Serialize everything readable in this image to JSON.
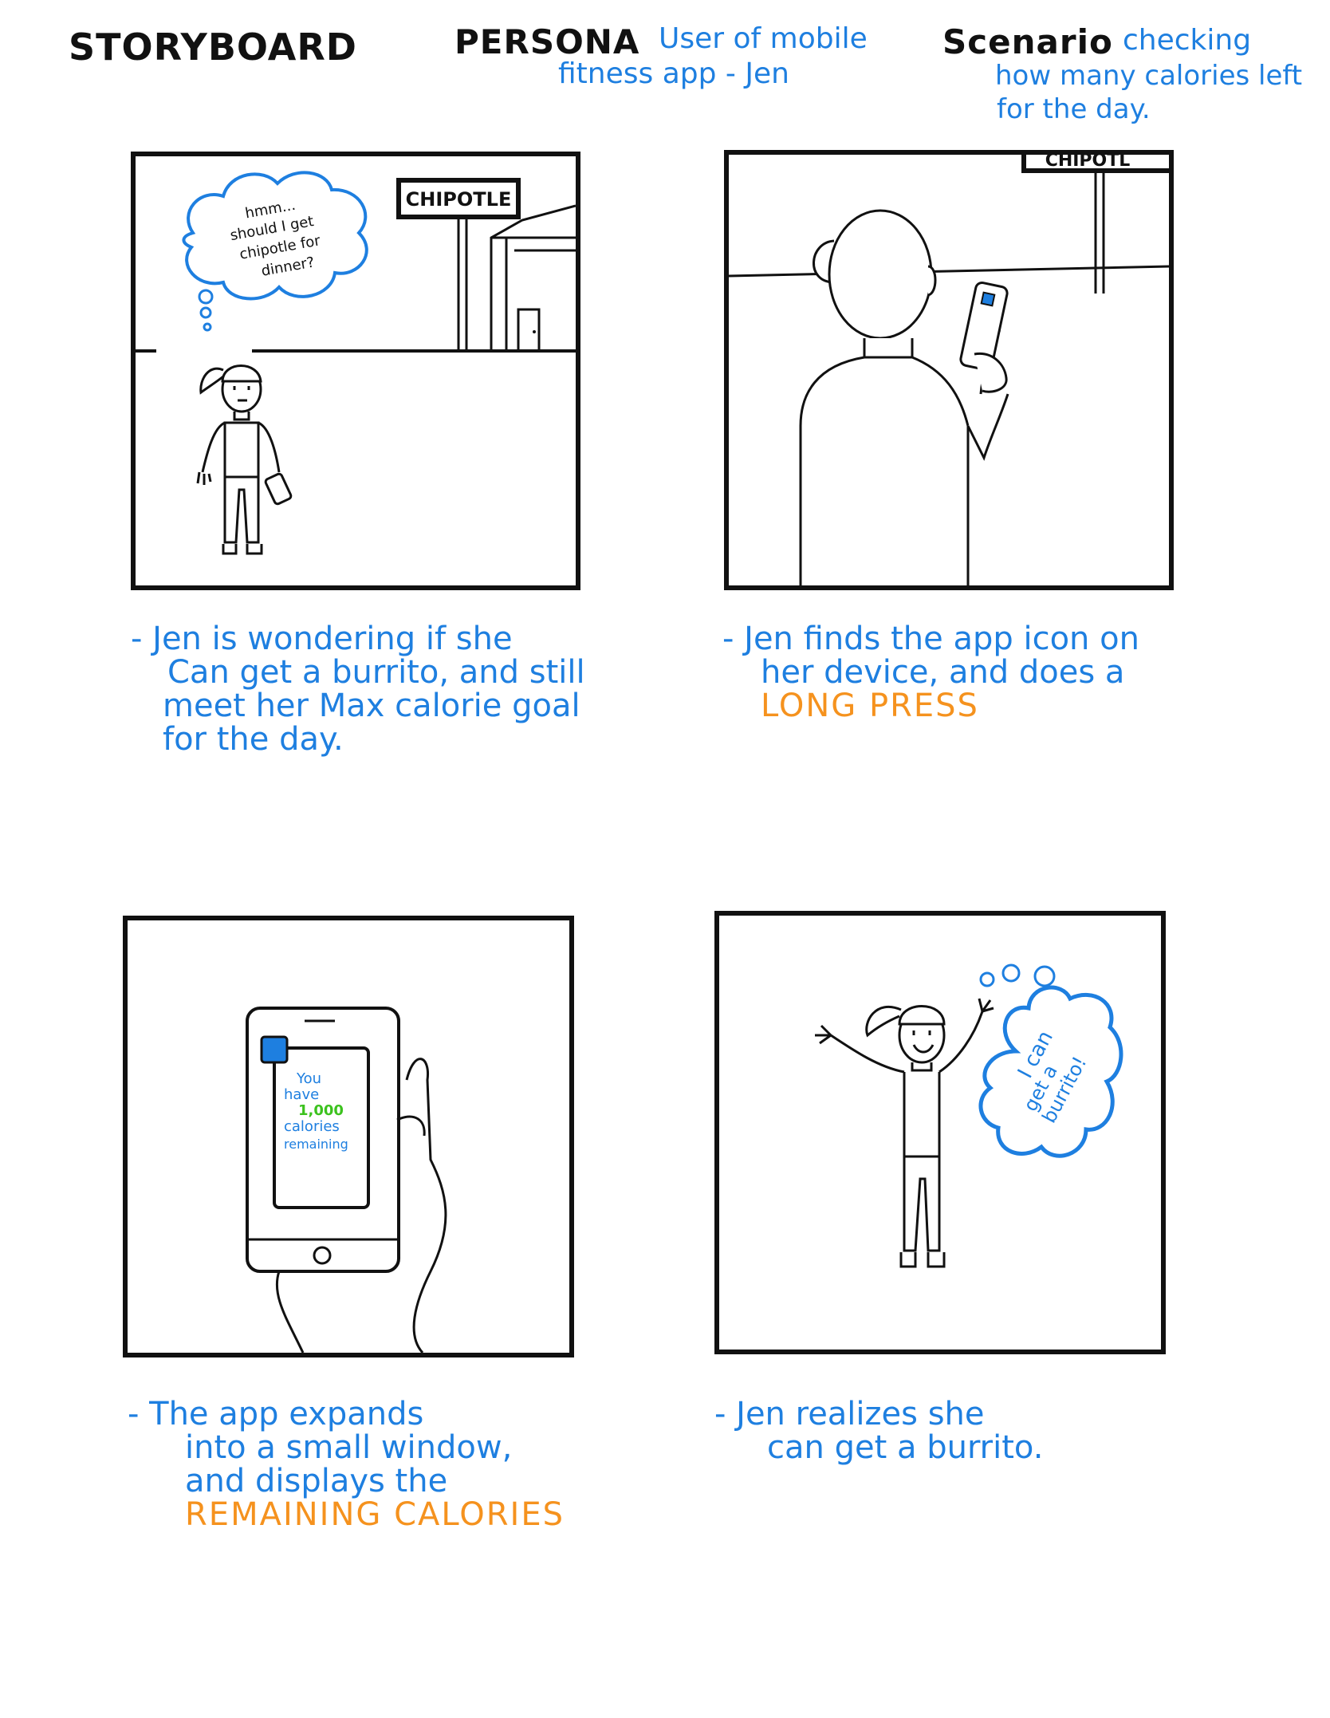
{
  "header": {
    "title": "STORYBOARD",
    "persona_label": "PERSONA",
    "persona_value_line1": "User of mobile",
    "persona_value_line2": "fitness app - Jen",
    "scenario_label": "Scenario",
    "scenario_value_line1": "checking",
    "scenario_value_line2": "how many calories left",
    "scenario_value_line3": "for the day."
  },
  "colors": {
    "ink": "#111111",
    "blue": "#1e7fe0",
    "orange": "#f5921e",
    "green": "#3cc21e"
  },
  "panels": [
    {
      "sign": "CHIPOTLE",
      "thought_lines": [
        "hmm...",
        "should I get",
        "chipotle for",
        "dinner?"
      ],
      "caption_lines": [
        "- Jen is wondering if she",
        "Can get a burrito, and still",
        "meet her Max calorie goal",
        "for the day."
      ]
    },
    {
      "sign": "CHIPOTL",
      "caption_lines": [
        "- Jen finds the app icon on",
        "her device, and does a"
      ],
      "caption_highlight": "LONG PRESS"
    },
    {
      "screen_lines": [
        "You",
        "have"
      ],
      "screen_number": "1,000",
      "screen_lines_after": [
        "calories",
        "remaining"
      ],
      "caption_lines": [
        "- The app expands",
        "into a small window,",
        "and displays the"
      ],
      "caption_highlight": "REMAINING CALORIES"
    },
    {
      "thought_lines": [
        "I can",
        "get a",
        "burrito!"
      ],
      "caption_lines": [
        "- Jen realizes she",
        "can get a burrito."
      ]
    }
  ]
}
